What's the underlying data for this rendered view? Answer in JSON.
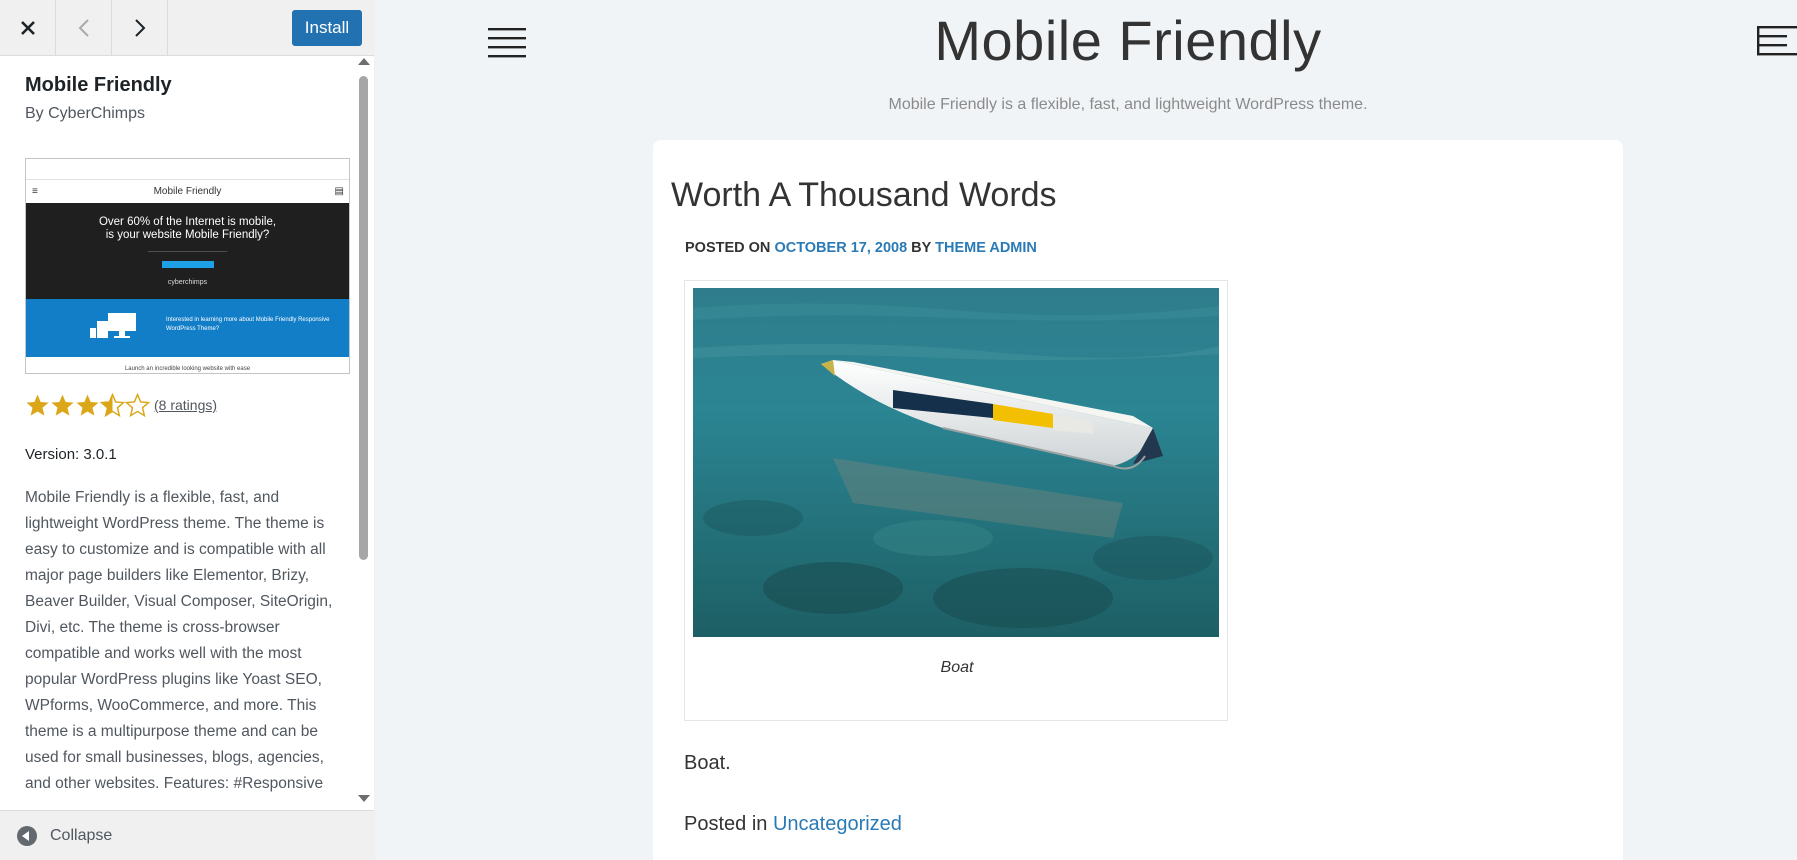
{
  "header": {
    "install_label": "Install"
  },
  "theme": {
    "name": "Mobile Friendly",
    "author": "By CyberChimps",
    "thumbnail": {
      "bar_title": "Mobile Friendly",
      "headline_1": "Over 60% of the Internet is mobile,",
      "headline_2": "is your website Mobile Friendly?",
      "logo_text": "cyberchimps",
      "blue_text_1": "Interested in learning more about Mobile Friendly Responsive",
      "blue_text_2": "WordPress Theme?",
      "bottom_text": "Launch an incredible looking website with ease"
    },
    "rating": {
      "stars": 3.5,
      "max": 5,
      "count_label": "(8 ratings)"
    },
    "version": "Version: 3.0.1",
    "description": "Mobile Friendly is a flexible, fast, and lightweight WordPress theme. The theme is easy to customize and is compatible with all major page builders like Elementor, Brizy, Beaver Builder, Visual Composer, SiteOrigin, Divi, etc. The theme is cross-browser compatible and works well with the most popular WordPress plugins like Yoast SEO, WPforms, WooCommerce, and more. This theme is a multipurpose theme and can be used for small businesses, blogs, agencies, and other websites. Features: #Responsive"
  },
  "footer": {
    "collapse_label": "Collapse"
  },
  "preview": {
    "site_title": "Mobile Friendly",
    "tagline": "Mobile Friendly is a flexible, fast, and lightweight WordPress theme.",
    "post": {
      "title": "Worth A Thousand Words",
      "meta_prefix": "POSTED ON ",
      "date": "OCTOBER 17, 2008",
      "meta_by": " BY ",
      "author": "THEME ADMIN",
      "caption": "Boat",
      "body": "Boat.",
      "category_prefix": "Posted in ",
      "category": "Uncategorized"
    }
  },
  "colors": {
    "accent": "#2271b1",
    "link": "#2a7ab6",
    "star": "#dba617"
  }
}
